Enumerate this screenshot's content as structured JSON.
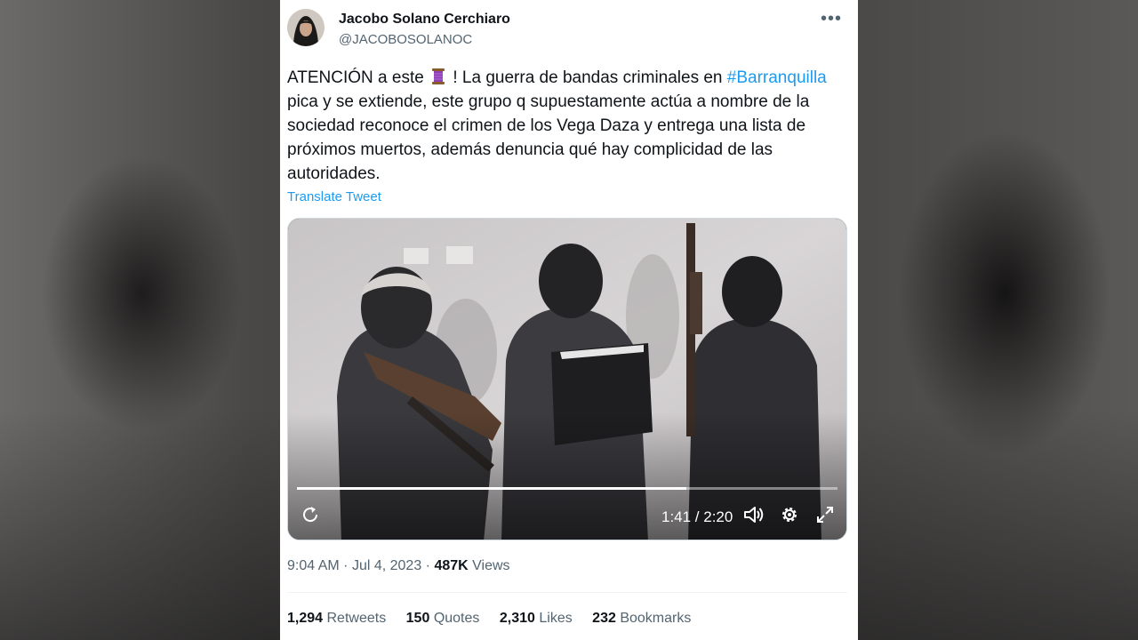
{
  "author": {
    "name": "Jacobo Solano Cerchiaro",
    "handle": "@JACOBOSOLANOC"
  },
  "tweet": {
    "text_before_emoji": "ATENCIÓN a este ",
    "emoji_icon": "thread-spool-icon",
    "text_before_hashtag": " ! La guerra de bandas criminales en ",
    "hashtag": "#Barranquilla",
    "text_after_hashtag": " pica y se extiende, este grupo q supuestamente actúa a nombre de la sociedad reconoce el crimen de los Vega Daza y entrega una lista de próximos muertos, además denuncia qué hay complicidad de las autoridades.",
    "translate_label": "Translate Tweet"
  },
  "video": {
    "current_time": "1:41",
    "duration": "2:20",
    "time_display": "1:41 / 2:20",
    "progress_fraction": 0.72
  },
  "meta": {
    "time": "9:04 AM",
    "date": "Jul 4, 2023",
    "views_count": "487K",
    "views_label": "Views"
  },
  "stats": {
    "retweets_count": "1,294",
    "retweets_label": "Retweets",
    "quotes_count": "150",
    "quotes_label": "Quotes",
    "likes_count": "2,310",
    "likes_label": "Likes",
    "bookmarks_count": "232",
    "bookmarks_label": "Bookmarks"
  },
  "colors": {
    "link": "#1d9bf0",
    "text_primary": "#0f1419",
    "text_secondary": "#536471"
  }
}
